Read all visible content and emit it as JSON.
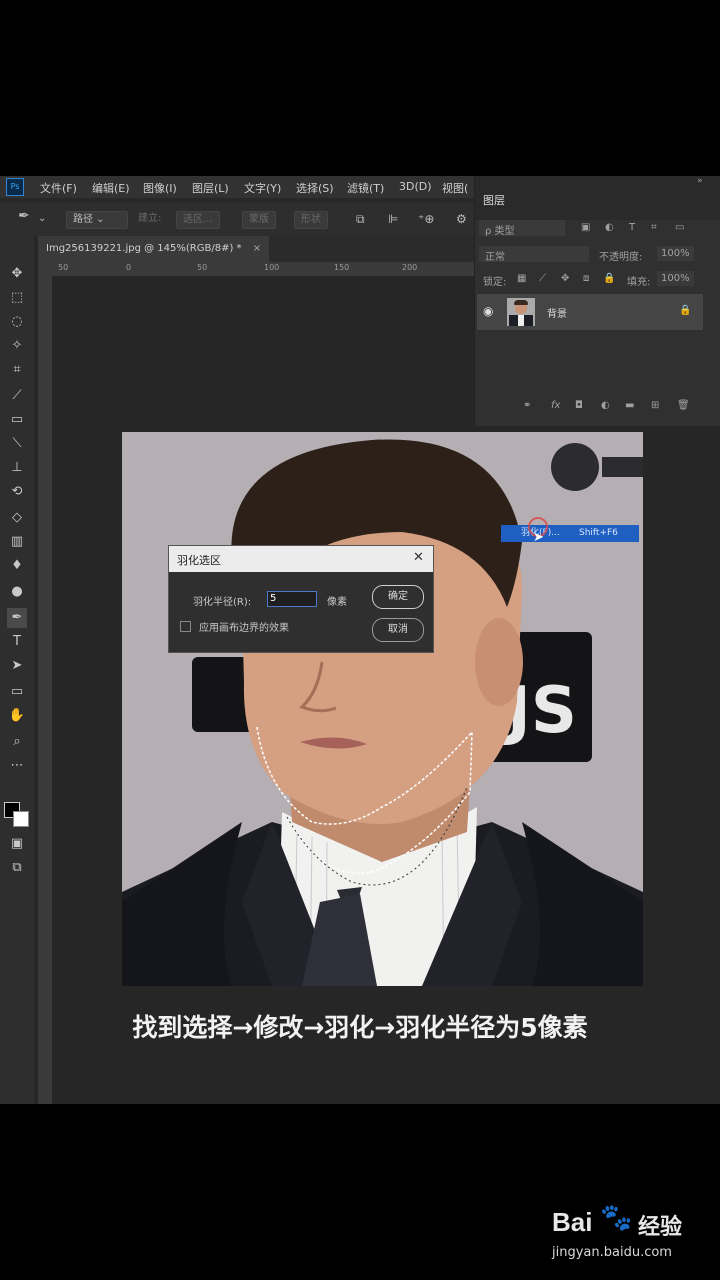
{
  "menubar": {
    "logo": "Ps",
    "items": [
      "文件(F)",
      "编辑(E)",
      "图像(I)",
      "图层(L)",
      "文字(Y)",
      "选择(S)",
      "滤镜(T)",
      "3D(D)",
      "视图("
    ]
  },
  "options_bar": {
    "mode": "路径",
    "build_label": "建立:",
    "selection_btn": "选区...",
    "mask_btn": "蒙版",
    "shape_btn": "形状"
  },
  "document": {
    "tab_label": "Img256139221.jpg @ 145%(RGB/8#) *",
    "ruler_top": [
      "50",
      "0",
      "50",
      "100",
      "150",
      "200"
    ]
  },
  "layers_panel": {
    "title": "图层",
    "filter_label": "ρ 类型",
    "blend_mode": "正常",
    "opacity_label": "不透明度:",
    "opacity_value": "100%",
    "lock_label": "锁定:",
    "fill_label": "填充:",
    "fill_value": "100%",
    "layer_name": "背景",
    "footer_icons": [
      "link-icon",
      "fx-icon",
      "mask-icon",
      "adjustment-icon",
      "folder-icon",
      "new-layer-icon",
      "trash-icon"
    ]
  },
  "context_menu": {
    "item": "羽化(F)...",
    "shortcut": "Shift+F6"
  },
  "dialog": {
    "title": "羽化选区",
    "radius_label": "羽化半径(R):",
    "radius_value": "5",
    "unit": "像素",
    "checkbox_label": "应用画布边界的效果",
    "ok": "确定",
    "cancel": "取消"
  },
  "caption": "找到选择→修改→羽化→羽化半径为5像素",
  "watermark": {
    "brand_left": "Bai",
    "brand_right": "经验",
    "url": "jingyan.baidu.com"
  },
  "colors": {
    "ps_bg": "#282828",
    "accent_blue": "#1e5fc1",
    "dialog_bg": "#2f2f2f"
  }
}
